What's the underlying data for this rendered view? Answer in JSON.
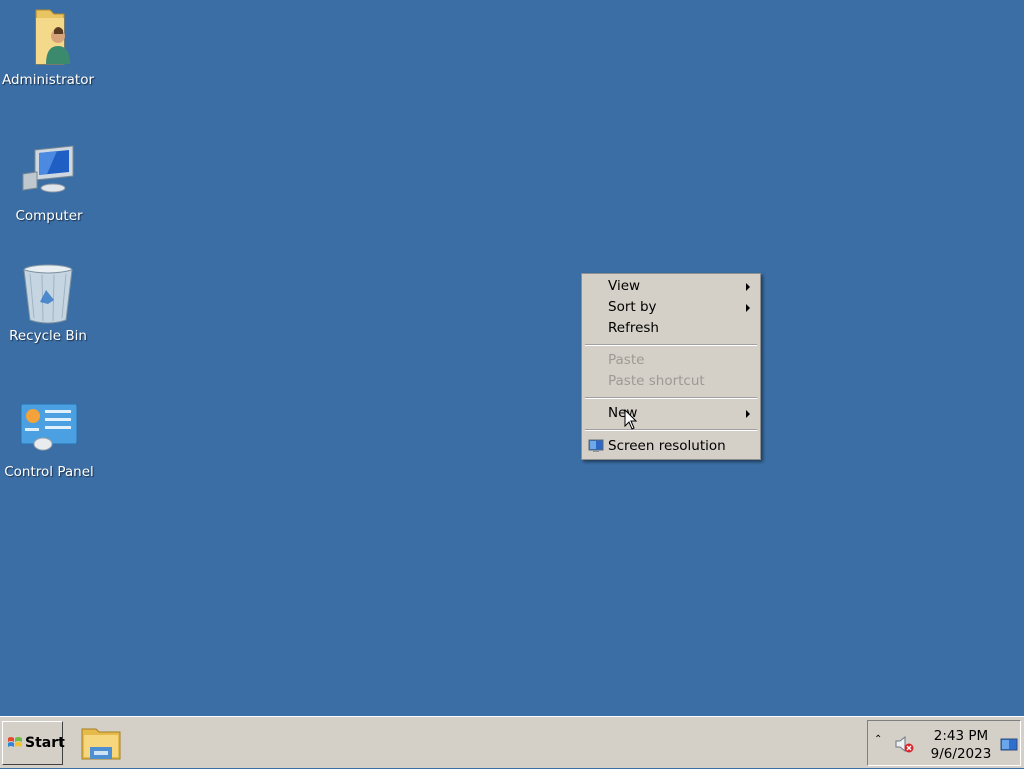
{
  "desktop": {
    "background_color": "#3a6ea5",
    "icons": [
      {
        "label": "Administrator",
        "icon": "user-folder-icon"
      },
      {
        "label": "Computer",
        "icon": "computer-icon"
      },
      {
        "label": "Recycle Bin",
        "icon": "recycle-bin-icon"
      },
      {
        "label": "Control Panel",
        "icon": "control-panel-icon"
      }
    ]
  },
  "context_menu": {
    "items": [
      {
        "label": "View",
        "submenu": true,
        "enabled": true
      },
      {
        "label": "Sort by",
        "submenu": true,
        "enabled": true
      },
      {
        "label": "Refresh",
        "submenu": false,
        "enabled": true
      },
      {
        "label": "Paste",
        "submenu": false,
        "enabled": false
      },
      {
        "label": "Paste shortcut",
        "submenu": false,
        "enabled": false
      },
      {
        "label": "New",
        "submenu": true,
        "enabled": true
      },
      {
        "label": "Screen resolution",
        "submenu": false,
        "enabled": true,
        "icon": "display-icon"
      }
    ]
  },
  "taskbar": {
    "start_label": "Start",
    "pinned": [
      {
        "icon": "windows-explorer-icon"
      }
    ],
    "tray": {
      "time": "2:43 PM",
      "date": "9/6/2023",
      "icons": [
        "show-hidden-icons-chevron",
        "speaker-muted-icon",
        "action-center-icon"
      ]
    }
  }
}
